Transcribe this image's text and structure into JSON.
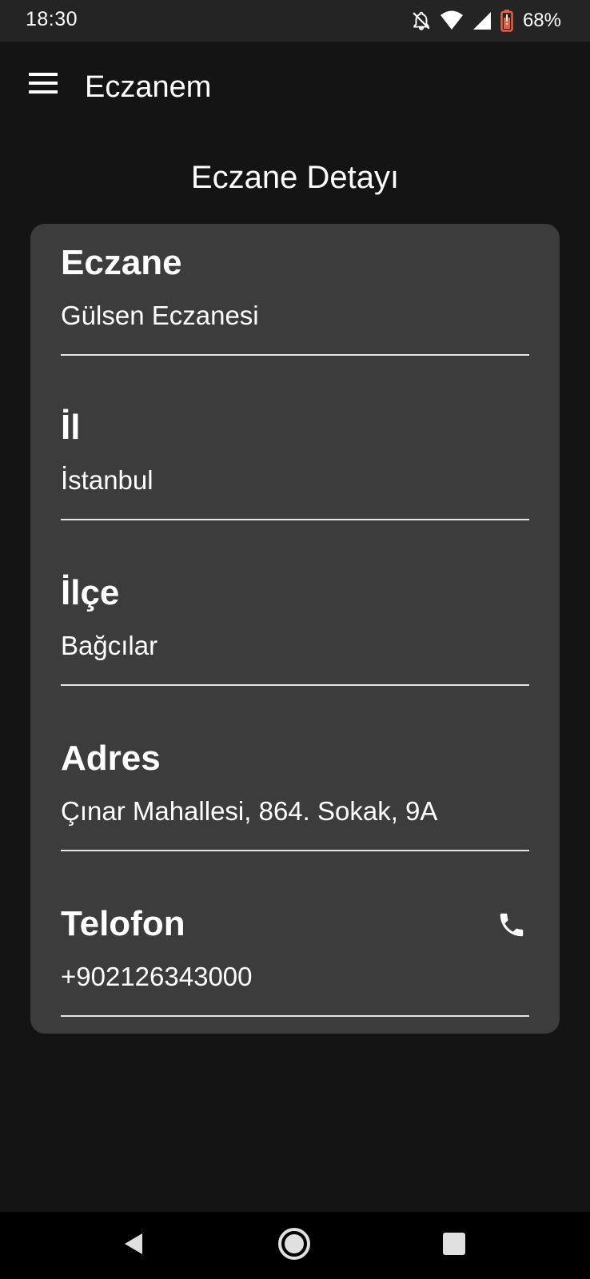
{
  "status_bar": {
    "time": "18:30",
    "battery": "68%",
    "icons": [
      "notifications-off-icon",
      "wifi-icon",
      "signal-icon",
      "battery-icon"
    ],
    "battery_color": "#e8603c"
  },
  "app_bar": {
    "title": "Eczanem",
    "menu_icon": "hamburger-menu-icon"
  },
  "page": {
    "title": "Eczane Detayı"
  },
  "fields": {
    "pharmacy": {
      "label": "Eczane",
      "value": "Gülsen Eczanesi"
    },
    "province": {
      "label": "İl",
      "value": "İstanbul"
    },
    "district": {
      "label": "İlçe",
      "value": "Bağcılar"
    },
    "address": {
      "label": "Adres",
      "value": "Çınar Mahallesi, 864. Sokak, 9A"
    },
    "phone": {
      "label": "Telofon",
      "value": "+902126343000",
      "icon": "phone-icon"
    }
  },
  "nav_bar": {
    "buttons": [
      "back-icon",
      "home-icon",
      "recents-icon"
    ]
  },
  "colors": {
    "background": "#141414",
    "status_bar": "#242424",
    "card": "#3c3c3c",
    "text": "#ffffff"
  }
}
